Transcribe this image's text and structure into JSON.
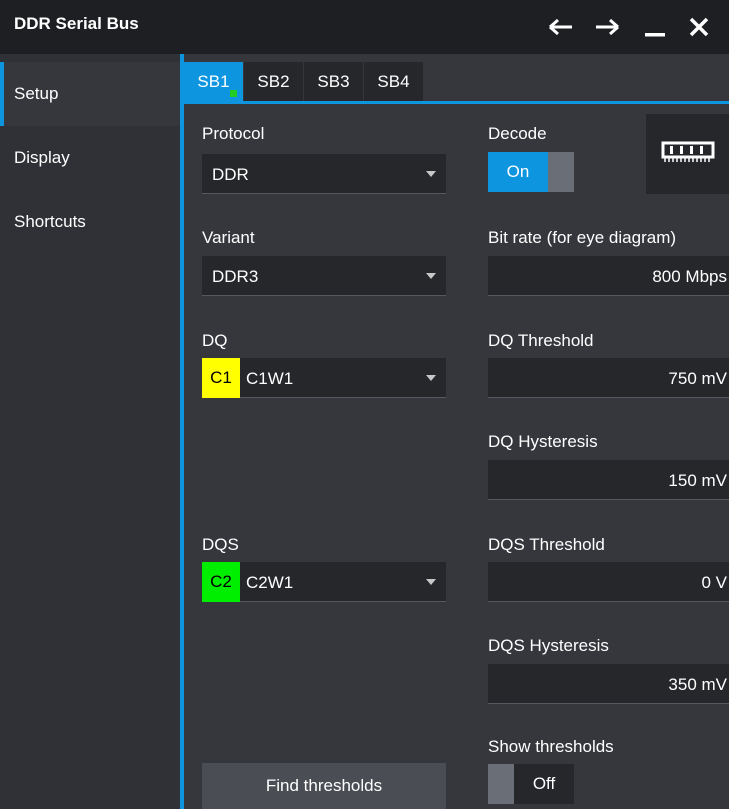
{
  "window": {
    "title": "DDR Serial Bus",
    "icons": [
      "back-arrow-icon",
      "forward-arrow-icon",
      "minimize-icon",
      "close-icon"
    ]
  },
  "sidebar": {
    "items": [
      {
        "label": "Setup",
        "active": true
      },
      {
        "label": "Display",
        "active": false
      },
      {
        "label": "Shortcuts",
        "active": false
      }
    ]
  },
  "tabs": [
    {
      "label": "SB1",
      "active": true
    },
    {
      "label": "SB2",
      "active": false
    },
    {
      "label": "SB3",
      "active": false
    },
    {
      "label": "SB4",
      "active": false
    }
  ],
  "left": {
    "protocol_label": "Protocol",
    "protocol_value": "DDR",
    "variant_label": "Variant",
    "variant_value": "DDR3",
    "dq_label": "DQ",
    "dq_badge": "C1",
    "dq_badge_color": "#ffff00",
    "dq_value": "C1W1",
    "dqs_label": "DQS",
    "dqs_badge": "C2",
    "dqs_badge_color": "#00ee00",
    "dqs_value": "C2W1",
    "find_button": "Find thresholds"
  },
  "right": {
    "decode_label": "Decode",
    "decode_state": "On",
    "memory_icon": "memory-chip-icon",
    "bitrate_label": "Bit rate (for eye diagram)",
    "bitrate_value": "800 Mbps",
    "dq_threshold_label": "DQ Threshold",
    "dq_threshold_value": "750 mV",
    "dq_hysteresis_label": "DQ Hysteresis",
    "dq_hysteresis_value": "150 mV",
    "dqs_threshold_label": "DQS Threshold",
    "dqs_threshold_value": "0 V",
    "dqs_hysteresis_label": "DQS Hysteresis",
    "dqs_hysteresis_value": "350 mV",
    "show_thresholds_label": "Show thresholds",
    "show_thresholds_state": "Off"
  },
  "colors": {
    "accent": "#0e95e0",
    "active_tab_dot": "#22cc22"
  }
}
